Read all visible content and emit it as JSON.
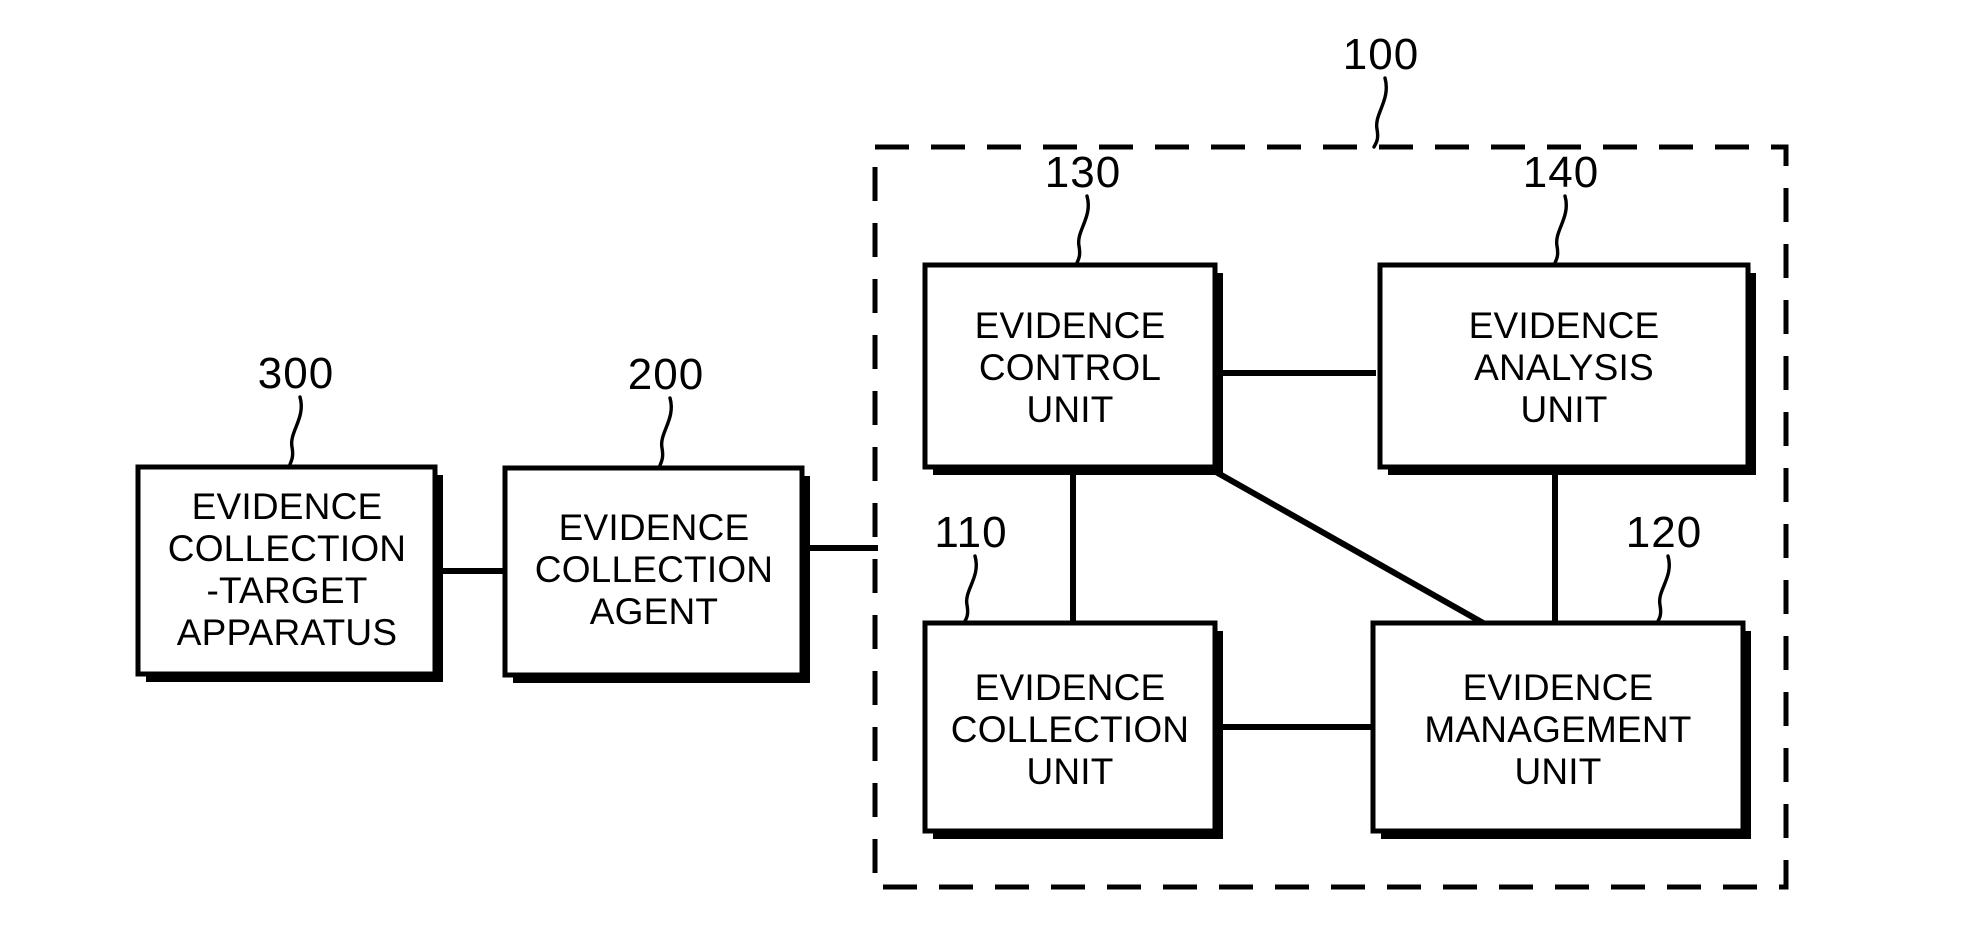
{
  "figure": {
    "type": "patent-block-diagram",
    "background_color": "#ffffff",
    "line_color": "#000000",
    "system_reference": {
      "number": "100",
      "style": "dashed-enclosure"
    },
    "blocks": [
      {
        "id": "evidence-collection-target-apparatus",
        "reference": "300",
        "lines": [
          "EVIDENCE",
          "COLLECTION",
          "-TARGET",
          "APPARATUS"
        ]
      },
      {
        "id": "evidence-collection-agent",
        "reference": "200",
        "lines": [
          "EVIDENCE",
          "COLLECTION",
          "AGENT"
        ]
      },
      {
        "id": "evidence-control-unit",
        "reference": "130",
        "lines": [
          "EVIDENCE",
          "CONTROL",
          "UNIT"
        ]
      },
      {
        "id": "evidence-analysis-unit",
        "reference": "140",
        "lines": [
          "EVIDENCE",
          "ANALYSIS",
          "UNIT"
        ]
      },
      {
        "id": "evidence-collection-unit",
        "reference": "110",
        "lines": [
          "EVIDENCE",
          "COLLECTION",
          "UNIT"
        ]
      },
      {
        "id": "evidence-management-unit",
        "reference": "120",
        "lines": [
          "EVIDENCE",
          "MANAGEMENT",
          "UNIT"
        ]
      }
    ],
    "connections": [
      {
        "from": "evidence-collection-target-apparatus",
        "to": "evidence-collection-agent"
      },
      {
        "from": "evidence-collection-agent",
        "to": "system-100-boundary"
      },
      {
        "from": "evidence-control-unit",
        "to": "evidence-analysis-unit"
      },
      {
        "from": "evidence-control-unit",
        "to": "evidence-collection-unit"
      },
      {
        "from": "evidence-control-unit",
        "to": "evidence-management-unit"
      },
      {
        "from": "evidence-analysis-unit",
        "to": "evidence-management-unit"
      },
      {
        "from": "evidence-collection-unit",
        "to": "evidence-management-unit"
      }
    ]
  }
}
